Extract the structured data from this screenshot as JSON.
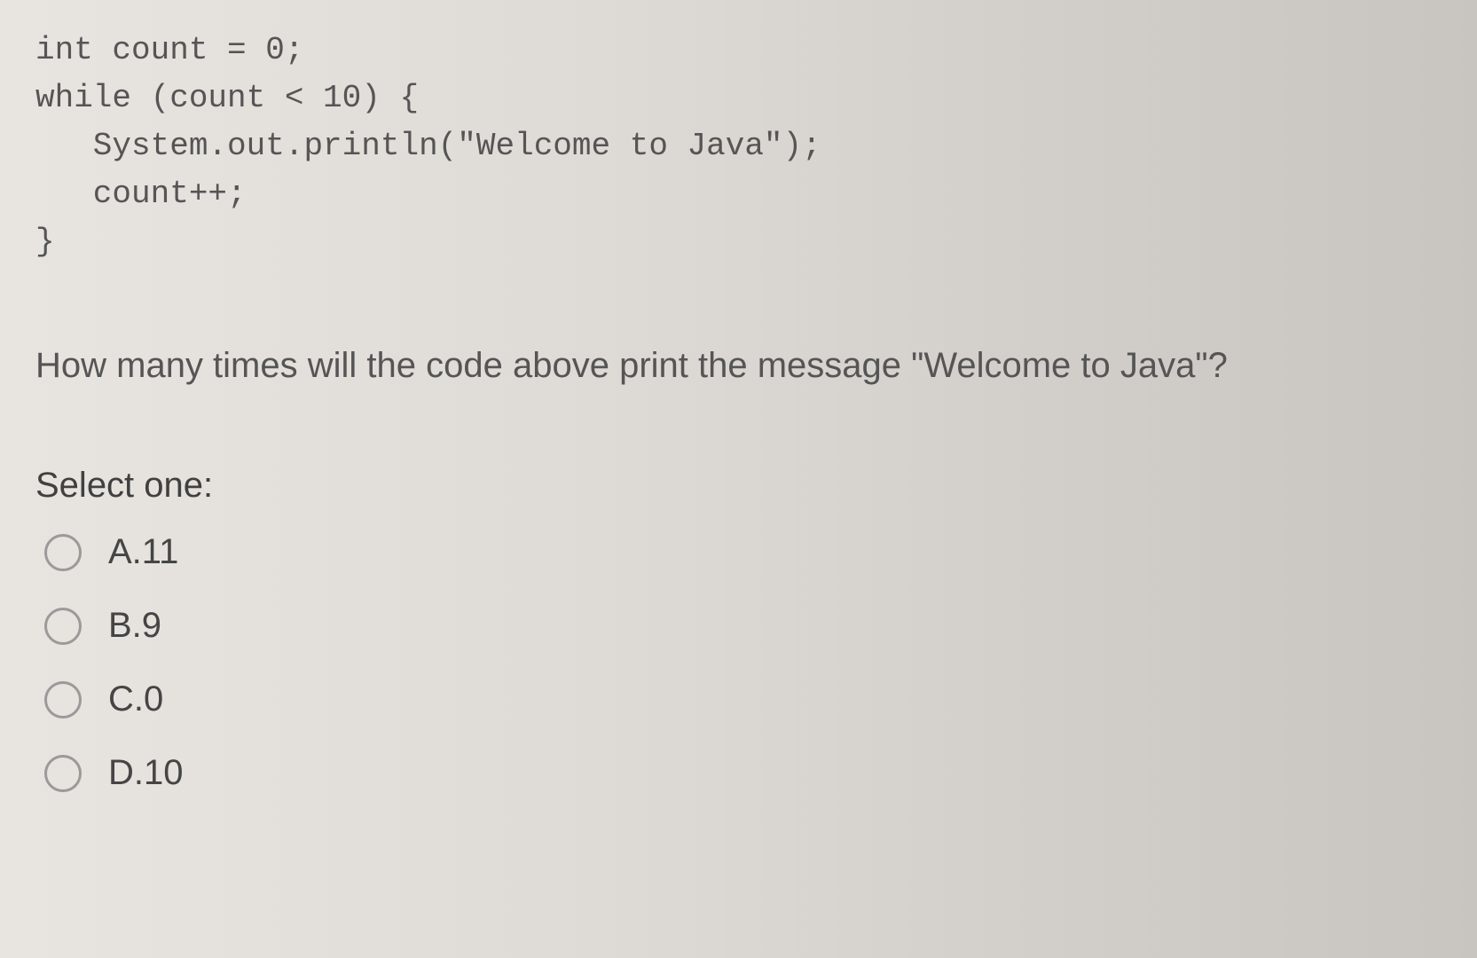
{
  "code": {
    "line1": "int count = 0;",
    "line2": "while (count < 10) {",
    "line3": "   System.out.println(\"Welcome to Java\");",
    "line4": "   count++;",
    "line5": "}"
  },
  "question": "How many times will the code above print the message \"Welcome to Java\"?",
  "select_label": "Select one:",
  "options": [
    {
      "label": "A.11"
    },
    {
      "label": "B.9"
    },
    {
      "label": "C.0"
    },
    {
      "label": "D.10"
    }
  ]
}
